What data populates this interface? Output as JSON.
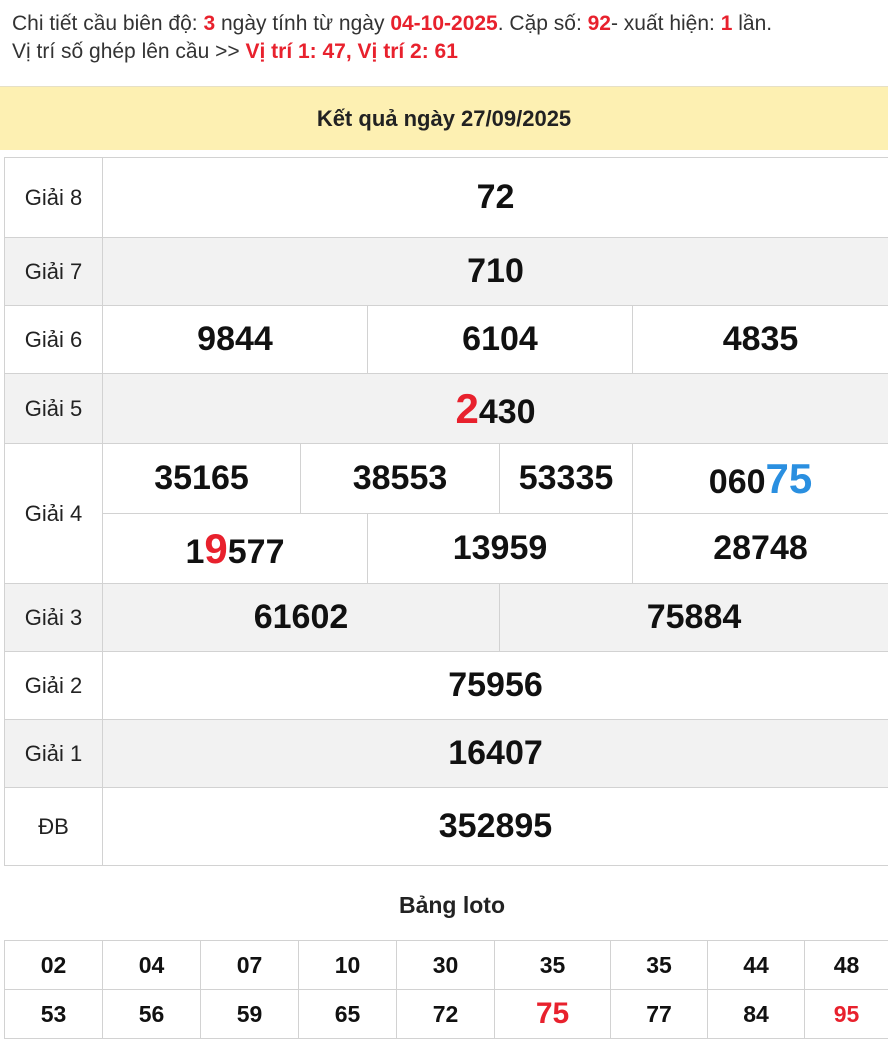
{
  "summary": {
    "line1_pre": "Chi tiết cầu biên độ: ",
    "range": "3",
    "line1_mid1": " ngày tính từ ngày ",
    "from_date": "04-10-2025",
    "line1_mid2": ". Cặp số: ",
    "pair": "92",
    "line1_mid3": "- xuất hiện: ",
    "times": "1",
    "line1_end": " lần.",
    "line2_pre": "Vị trí số ghép lên cầu >> ",
    "positions": "Vị trí 1: 47, Vị trí 2: 61"
  },
  "result_title": "Kết quả ngày 27/09/2025",
  "prizes": {
    "g8": {
      "label": "Giải 8",
      "value": "72"
    },
    "g7": {
      "label": "Giải 7",
      "value": "710"
    },
    "g6": {
      "label": "Giải 6",
      "values": [
        "9844",
        "6104",
        "4835"
      ]
    },
    "g5": {
      "label": "Giải 5",
      "hl": "2",
      "rest": "430"
    },
    "g4": {
      "label": "Giải 4",
      "row1": [
        "35165",
        "38553",
        "53335"
      ],
      "r1c4_pre": "060",
      "r1c4_hl": "75",
      "r2c1_pre": "1",
      "r2c1_hl": "9",
      "r2c1_post": "577",
      "row2": [
        "13959",
        "28748"
      ]
    },
    "g3": {
      "label": "Giải 3",
      "values": [
        "61602",
        "75884"
      ]
    },
    "g2": {
      "label": "Giải 2",
      "value": "75956"
    },
    "g1": {
      "label": "Giải 1",
      "value": "16407"
    },
    "db": {
      "label": "ĐB",
      "value": "352895"
    }
  },
  "loto": {
    "title": "Bảng loto",
    "row1": [
      "02",
      "04",
      "07",
      "10",
      "30",
      "35",
      "35",
      "44",
      "48"
    ],
    "row2": [
      "53",
      "56",
      "59",
      "65",
      "72",
      "75",
      "77",
      "84",
      "95"
    ]
  },
  "colors": {
    "highlight_red": "#e8212d",
    "highlight_blue": "#2a8fe0",
    "header_bg": "#fdf0b2"
  }
}
